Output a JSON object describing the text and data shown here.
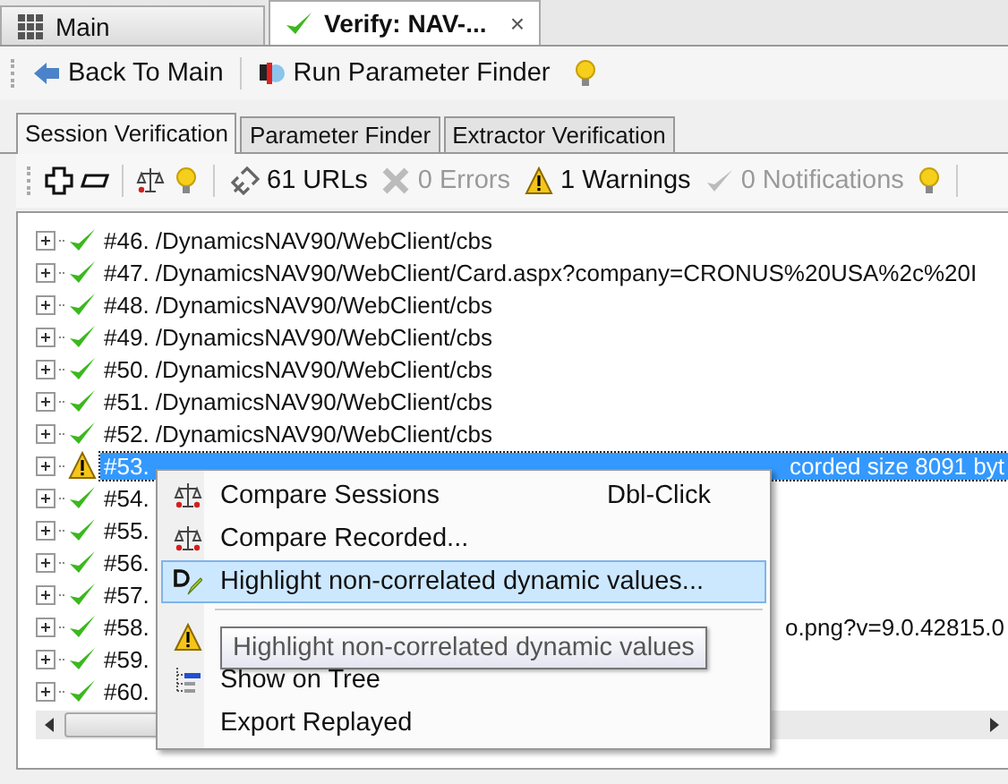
{
  "doc_tabs": [
    {
      "label": "Main",
      "selected": false
    },
    {
      "label": "Verify: NAV-...",
      "selected": true,
      "close": "×"
    }
  ],
  "toolbar": [
    {
      "kind": "back",
      "label": "Back To Main"
    },
    {
      "kind": "finder",
      "label": "Run Parameter Finder"
    },
    {
      "kind": "bulb"
    }
  ],
  "tabs": [
    {
      "label": "Session Verification",
      "selected": true
    },
    {
      "label": "Parameter Finder",
      "selected": false
    },
    {
      "label": "Extractor Verification",
      "selected": false
    }
  ],
  "summary": [
    {
      "kind": "expand"
    },
    {
      "kind": "collapse"
    },
    {
      "kind": "sep"
    },
    {
      "kind": "scale"
    },
    {
      "kind": "bulb"
    },
    {
      "kind": "sep"
    },
    {
      "kind": "link",
      "label": "61 URLs",
      "disabled": false
    },
    {
      "kind": "error",
      "label": "0 Errors",
      "disabled": true
    },
    {
      "kind": "warning",
      "label": "1 Warnings",
      "disabled": false
    },
    {
      "kind": "notify",
      "label": "0 Notifications",
      "disabled": true
    },
    {
      "kind": "bulb"
    },
    {
      "kind": "sep"
    }
  ],
  "rows": [
    {
      "kind": "ok",
      "text": "#46. /DynamicsNAV90/WebClient/cbs",
      "selected": false
    },
    {
      "kind": "ok",
      "text": "#47. /DynamicsNAV90/WebClient/Card.aspx?company=CRONUS%20USA%2c%20I",
      "selected": false
    },
    {
      "kind": "ok",
      "text": "#48. /DynamicsNAV90/WebClient/cbs",
      "selected": false
    },
    {
      "kind": "ok",
      "text": "#49. /DynamicsNAV90/WebClient/cbs",
      "selected": false
    },
    {
      "kind": "ok",
      "text": "#50. /DynamicsNAV90/WebClient/cbs",
      "selected": false
    },
    {
      "kind": "ok",
      "text": "#51. /DynamicsNAV90/WebClient/cbs",
      "selected": false
    },
    {
      "kind": "ok",
      "text": "#52. /DynamicsNAV90/WebClient/cbs",
      "selected": false
    },
    {
      "kind": "warning",
      "text": "#53.",
      "tail": "corded size 8091 byt",
      "selected": true
    },
    {
      "kind": "ok",
      "text": "#54.",
      "selected": false
    },
    {
      "kind": "ok",
      "text": "#55.",
      "selected": false
    },
    {
      "kind": "ok",
      "text": "#56.",
      "selected": false
    },
    {
      "kind": "ok",
      "text": "#57.",
      "selected": false
    },
    {
      "kind": "ok",
      "text": "#58.",
      "tail": "o.png?v=9.0.42815.0",
      "selected": false
    },
    {
      "kind": "ok",
      "text": "#59.",
      "selected": false
    },
    {
      "kind": "ok",
      "text": "#60.",
      "selected": false
    }
  ],
  "context_menu": [
    {
      "kind": "item",
      "label": "Compare Sessions",
      "shortcut": "Dbl-Click",
      "selected": false
    },
    {
      "kind": "item",
      "label": "Compare Recorded...",
      "selected": false
    },
    {
      "kind": "item",
      "label": "Highlight non-correlated dynamic values...",
      "selected": true
    },
    {
      "kind": "separator"
    },
    {
      "kind": "item",
      "selected": false
    },
    {
      "kind": "item",
      "label": "Show on Tree",
      "selected": false
    },
    {
      "kind": "item",
      "label": "Export Replayed",
      "selected": false
    }
  ],
  "tooltip": "Highlight non-correlated dynamic values"
}
